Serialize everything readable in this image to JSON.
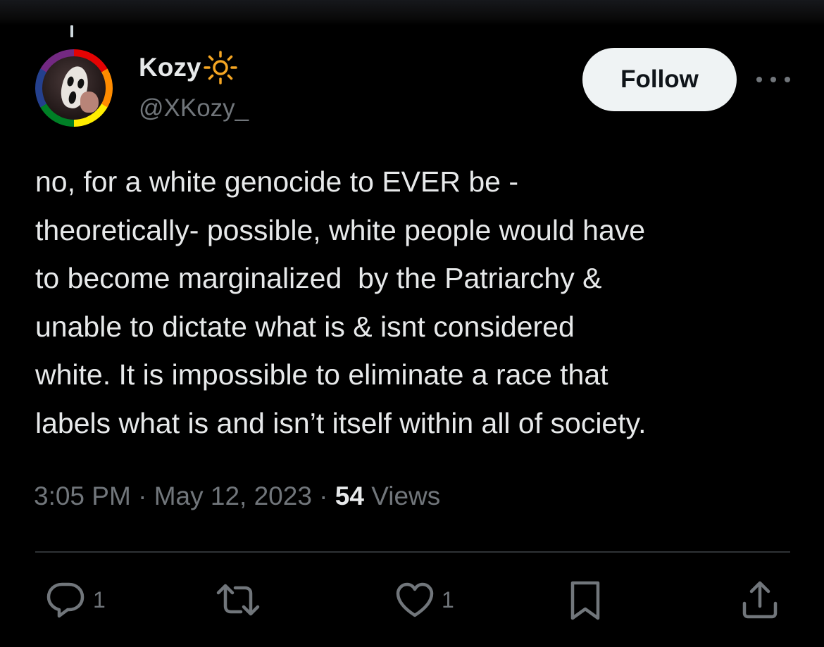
{
  "tweet": {
    "author": {
      "display_name": "Kozy",
      "name_emoji": "sun-icon",
      "handle": "@XKozy_",
      "avatar": "avatar"
    },
    "follow_label": "Follow",
    "more_icon": "more-icon",
    "text": "no, for a white genocide to EVER be -\ntheoretically- possible, white people would have\nto become marginalized  by the Patriarchy &\nunable to dictate what is & isnt considered\nwhite. It is impossible to eliminate a race that\nlabels what is and isn’t itself within all of society.",
    "time": "3:05 PM",
    "date": "May 12, 2023",
    "views_count": "54",
    "views_label": "Views",
    "actions": {
      "reply": {
        "icon": "reply-icon",
        "count": "1"
      },
      "repost": {
        "icon": "repost-icon",
        "count": ""
      },
      "like": {
        "icon": "heart-icon",
        "count": "1"
      },
      "bookmark": {
        "icon": "bookmark-icon"
      },
      "share": {
        "icon": "share-icon"
      }
    }
  },
  "colors": {
    "background": "#000000",
    "primary_text": "#e7e9ea",
    "secondary_text": "#71767b",
    "follow_bg": "#eff3f4",
    "divider": "#2f3336",
    "sun_emoji": "#f5a623"
  }
}
